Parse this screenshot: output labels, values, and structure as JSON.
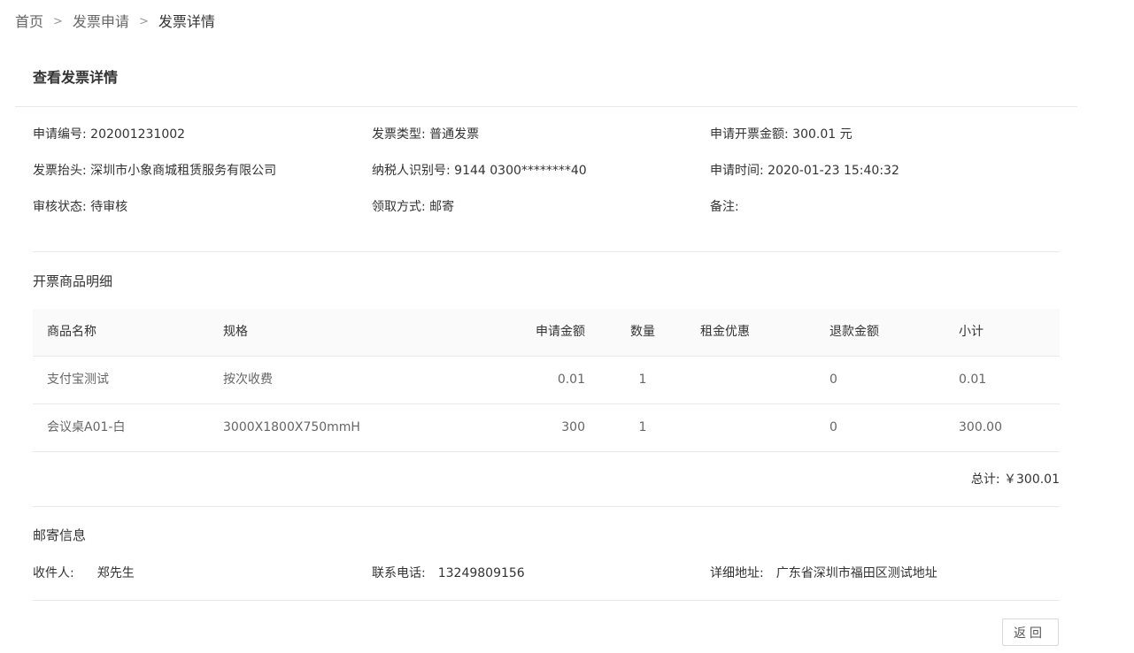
{
  "breadcrumb": {
    "items": [
      "首页",
      "发票申请",
      "发票详情"
    ],
    "separator": ">"
  },
  "card_title": "查看发票详情",
  "info": {
    "apply_no_label": "申请编号:",
    "apply_no": "202001231002",
    "invoice_type_label": "发票类型:",
    "invoice_type": "普通发票",
    "apply_amount_label": "申请开票金额:",
    "apply_amount": "300.01 元",
    "invoice_header_label": "发票抬头:",
    "invoice_header": "深圳市小象商城租赁服务有限公司",
    "taxpayer_id_label": "纳税人识别号:",
    "taxpayer_id": "9144 0300********40",
    "apply_time_label": "申请时间:",
    "apply_time": "2020-01-23 15:40:32",
    "audit_status_label": "审核状态:",
    "audit_status": "待审核",
    "pickup_method_label": "领取方式:",
    "pickup_method": "邮寄",
    "remark_label": "备注:",
    "remark": ""
  },
  "goods_section": {
    "title": "开票商品明细",
    "columns": {
      "name": "商品名称",
      "spec": "规格",
      "amount": "申请金额",
      "qty": "数量",
      "discount": "租金优惠",
      "refund": "退款金额",
      "subtotal": "小计"
    },
    "rows": [
      {
        "name": "支付宝测试",
        "spec": "按次收费",
        "amount": "0.01",
        "qty": "1",
        "discount": "",
        "refund": "0",
        "subtotal": "0.01"
      },
      {
        "name": "会议桌A01-白",
        "spec": "3000X1800X750mmH",
        "amount": "300",
        "qty": "1",
        "discount": "",
        "refund": "0",
        "subtotal": "300.00"
      }
    ],
    "total": "总计: ￥300.01"
  },
  "mail_section": {
    "title": "邮寄信息",
    "recipient_label": "收件人:",
    "recipient": "郑先生",
    "phone_label": "联系电话:",
    "phone": "13249809156",
    "address_label": "详细地址:",
    "address": "广东省深圳市福田区测试地址"
  },
  "actions": {
    "back_label": "返回"
  }
}
